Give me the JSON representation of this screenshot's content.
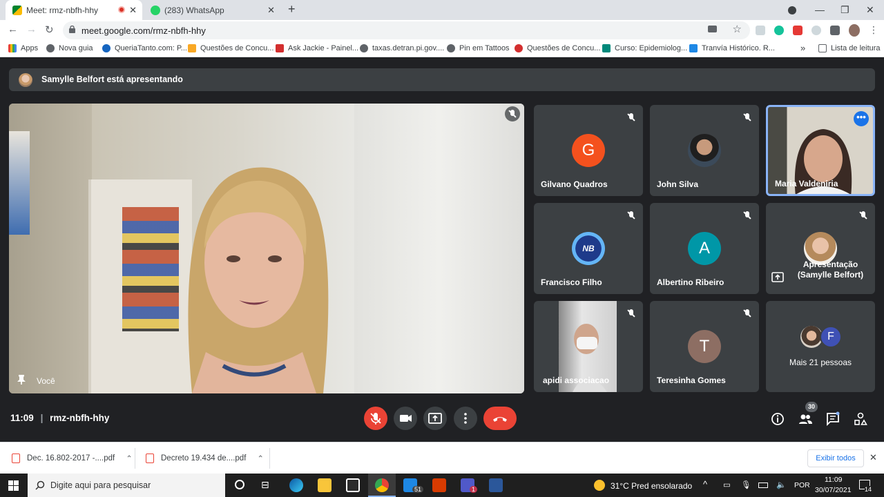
{
  "browser": {
    "tabs": [
      {
        "title": "Meet: rmz-nbfh-hhy",
        "active": true
      },
      {
        "title": "(283) WhatsApp",
        "active": false
      }
    ],
    "url": "meet.google.com/rmz-nbfh-hhy",
    "bookmarks": [
      "Apps",
      "Nova guia",
      "QueriaTanto.com: P...",
      "Questões de Concu...",
      "Ask Jackie - Painel...",
      "taxas.detran.pi.gov....",
      "Pin em Tattoos",
      "Questões de Concu...",
      "Curso: Epidemiolog...",
      "Tranvía Histórico. R..."
    ],
    "reading_list": "Lista de leitura",
    "overflow": "»"
  },
  "meet": {
    "presenter_text": "Samylle Belfort está apresentando",
    "self_label": "Você",
    "participants": [
      {
        "name": "Gilvano Quadros",
        "initial": "G",
        "color": "#f4511e"
      },
      {
        "name": "John Silva",
        "initial": "",
        "color": "#2b2b2b"
      },
      {
        "name": "Maria Valdeniria",
        "initial": "",
        "color": "#cfc4b8"
      },
      {
        "name": "Francisco Filho",
        "initial": "",
        "color": "#1e88e5"
      },
      {
        "name": "Albertino Ribeiro",
        "initial": "A",
        "color": "#0097a7"
      },
      {
        "name": "Apresentação (Samylle Belfort)",
        "initial": "",
        "color": "#d9c2ad"
      },
      {
        "name": "apidi associacao",
        "initial": "",
        "color": "#d8d8d8"
      },
      {
        "name": "Teresinha Gomes",
        "initial": "T",
        "color": "#8d6e63"
      },
      {
        "name": "Mais 21 pessoas",
        "initial": "F",
        "color": "#3f51b5"
      }
    ],
    "nb_logo": "NB",
    "more_dots": "•••",
    "time": "11:09",
    "meeting_code": "rmz-nbfh-hhy",
    "people_count": "30"
  },
  "downloads": {
    "items": [
      "Dec. 16.802-2017 -....pdf",
      "Decreto 19.434 de....pdf"
    ],
    "show_all": "Exibir todos"
  },
  "taskbar": {
    "search_placeholder": "Digite aqui para pesquisar",
    "weather": "31°C  Pred ensolarado",
    "lang": "POR",
    "time": "11:09",
    "date": "30/07/2021",
    "mail_badge": "51",
    "teams_badge": "1",
    "notif_count": "14"
  }
}
